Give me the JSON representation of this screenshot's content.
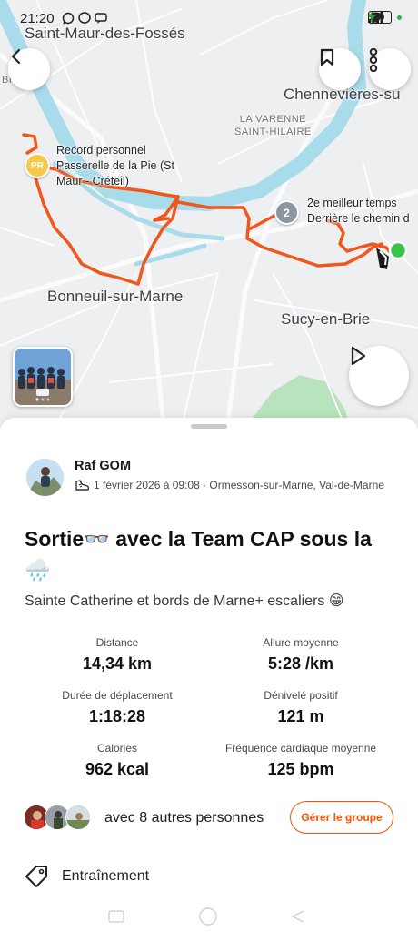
{
  "status_bar": {
    "time": "21:20",
    "battery": "20",
    "icons": [
      "whatsapp-icon",
      "messenger-icon",
      "chat-icon",
      "bluetooth-icon",
      "signal-icon",
      "wifi-icon",
      "battery-icon",
      "charging-icon"
    ]
  },
  "map": {
    "places": {
      "saint_maur": "Saint-Maur-des-Fossés",
      "bry_partial": "BRY",
      "chennevieres": "Chennevières-su",
      "varenne_1": "LA VARENNE",
      "varenne_2": "SAINT-HILAIRE",
      "bonneuil": "Bonneuil-sur-Marne",
      "sucy": "Sucy-en-Brie"
    },
    "segments": {
      "pr_line1": "Record personnel",
      "pr_line2": "Passerelle de la Pie (St",
      "pr_line3": "Maur - Créteil)",
      "second_line1": "2e meilleur temps",
      "second_line2": "Derrière le chemin d"
    },
    "badges": {
      "pr": "PR",
      "second": "2"
    },
    "route_color": "#f0571c",
    "river_color": "#a9dceb"
  },
  "activity": {
    "athlete": "Raf GOM",
    "meta": "1 février 2026 à 09:08 · Ormesson-sur-Marne, Val-de-Marne",
    "title": "Sortie👓 avec la Team CAP sous la 🌧️",
    "description": "Sainte Catherine et bords de Marne+ escaliers 😁",
    "stats": [
      {
        "label": "Distance",
        "value": "14,34 km"
      },
      {
        "label": "Allure moyenne",
        "value": "5:28 /km"
      },
      {
        "label": "Durée de déplacement",
        "value": "1:18:28"
      },
      {
        "label": "Dénivelé positif",
        "value": "121 m"
      },
      {
        "label": "Calories",
        "value": "962 kcal"
      },
      {
        "label": "Fréquence cardiaque moyenne",
        "value": "125 bpm"
      }
    ],
    "group_text": "avec 8 autres personnes",
    "group_button": "Gérer le groupe",
    "workout_type": "Entraînement"
  },
  "colors": {
    "accent": "#fc5200"
  }
}
